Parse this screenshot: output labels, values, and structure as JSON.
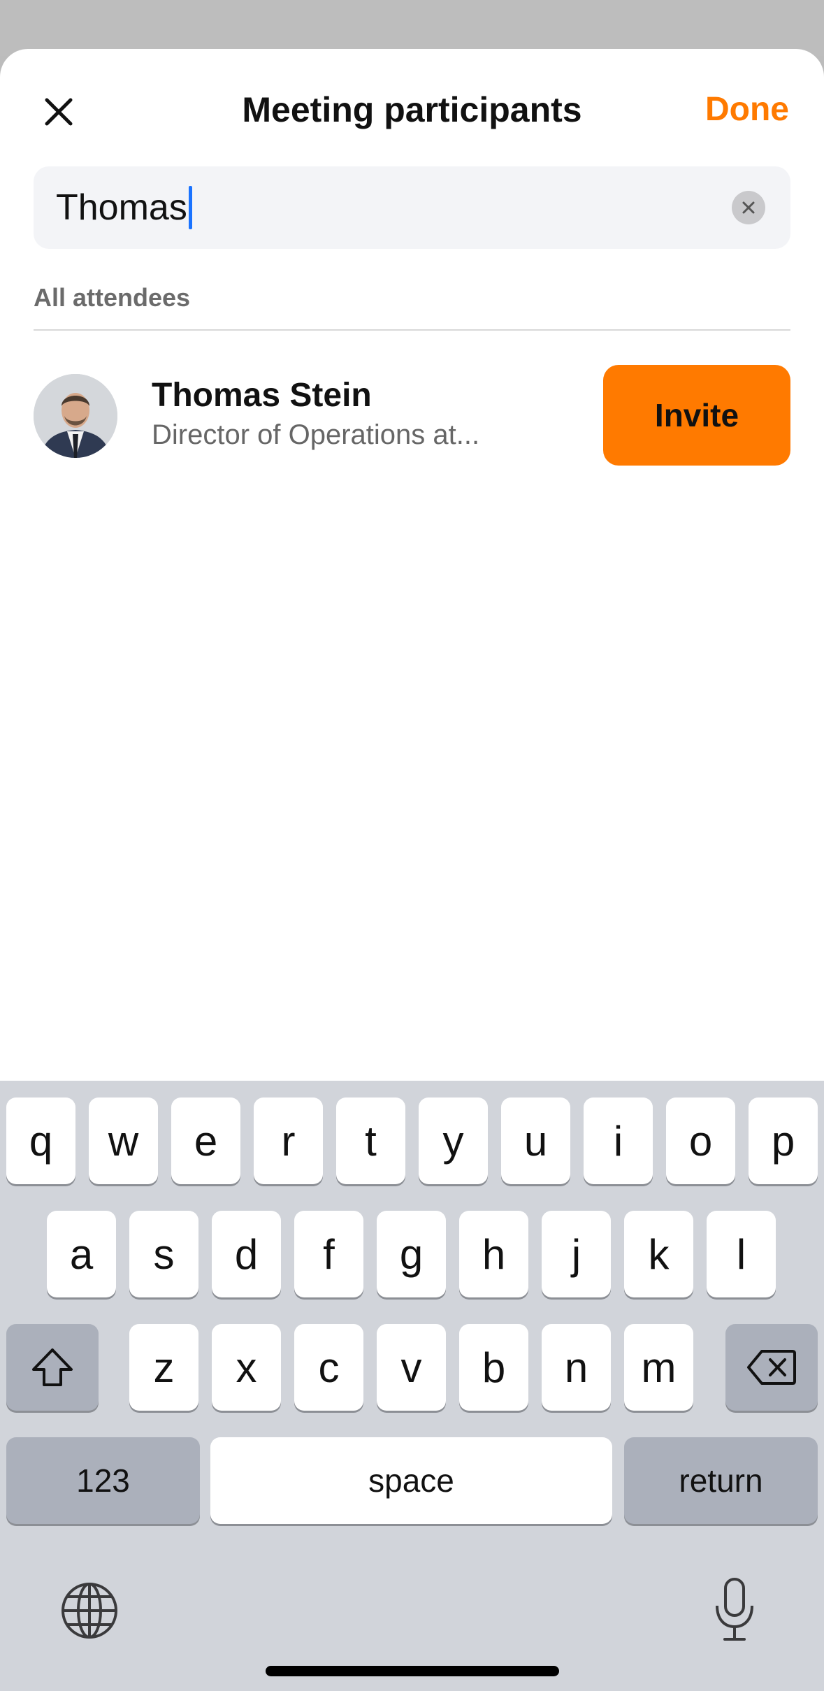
{
  "header": {
    "title": "Meeting participants",
    "done_label": "Done"
  },
  "search": {
    "value": "Thomas"
  },
  "section": {
    "label": "All attendees"
  },
  "results": [
    {
      "name": "Thomas Stein",
      "subtitle": "Director of Operations at...",
      "action_label": "Invite"
    }
  ],
  "keyboard": {
    "row1": [
      "q",
      "w",
      "e",
      "r",
      "t",
      "y",
      "u",
      "i",
      "o",
      "p"
    ],
    "row2": [
      "a",
      "s",
      "d",
      "f",
      "g",
      "h",
      "j",
      "k",
      "l"
    ],
    "row3": [
      "z",
      "x",
      "c",
      "v",
      "b",
      "n",
      "m"
    ],
    "numbers_label": "123",
    "space_label": "space",
    "return_label": "return"
  },
  "colors": {
    "accent": "#ff7a00",
    "caret": "#1a73ff"
  },
  "icons": {
    "close": "close-icon",
    "clear": "clear-icon",
    "shift": "shift-icon",
    "delete": "backspace-icon",
    "globe": "globe-icon",
    "mic": "microphone-icon"
  }
}
